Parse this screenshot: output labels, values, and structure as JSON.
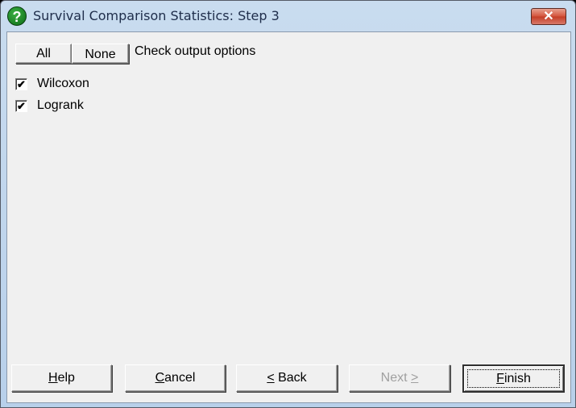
{
  "window": {
    "title": "Survival Comparison Statistics: Step 3",
    "app_icon": "help-question-icon",
    "close_glyph": "✕"
  },
  "toolbar": {
    "all_label": "All",
    "none_label": "None",
    "instruction": "Check output options"
  },
  "options": [
    {
      "label": "Wilcoxon",
      "checked": true,
      "glyph": "✔"
    },
    {
      "label": "Logrank",
      "checked": true,
      "glyph": "✔"
    }
  ],
  "footer": {
    "help": {
      "mnemonic": "H",
      "rest": "elp"
    },
    "cancel": {
      "mnemonic": "C",
      "rest": "ancel"
    },
    "back": {
      "mnemonic": "<",
      "rest": " Back"
    },
    "next": {
      "pre": "Next ",
      "mnemonic": ">",
      "enabled": false
    },
    "finish": {
      "mnemonic": "F",
      "rest": "inish",
      "default": true
    }
  }
}
